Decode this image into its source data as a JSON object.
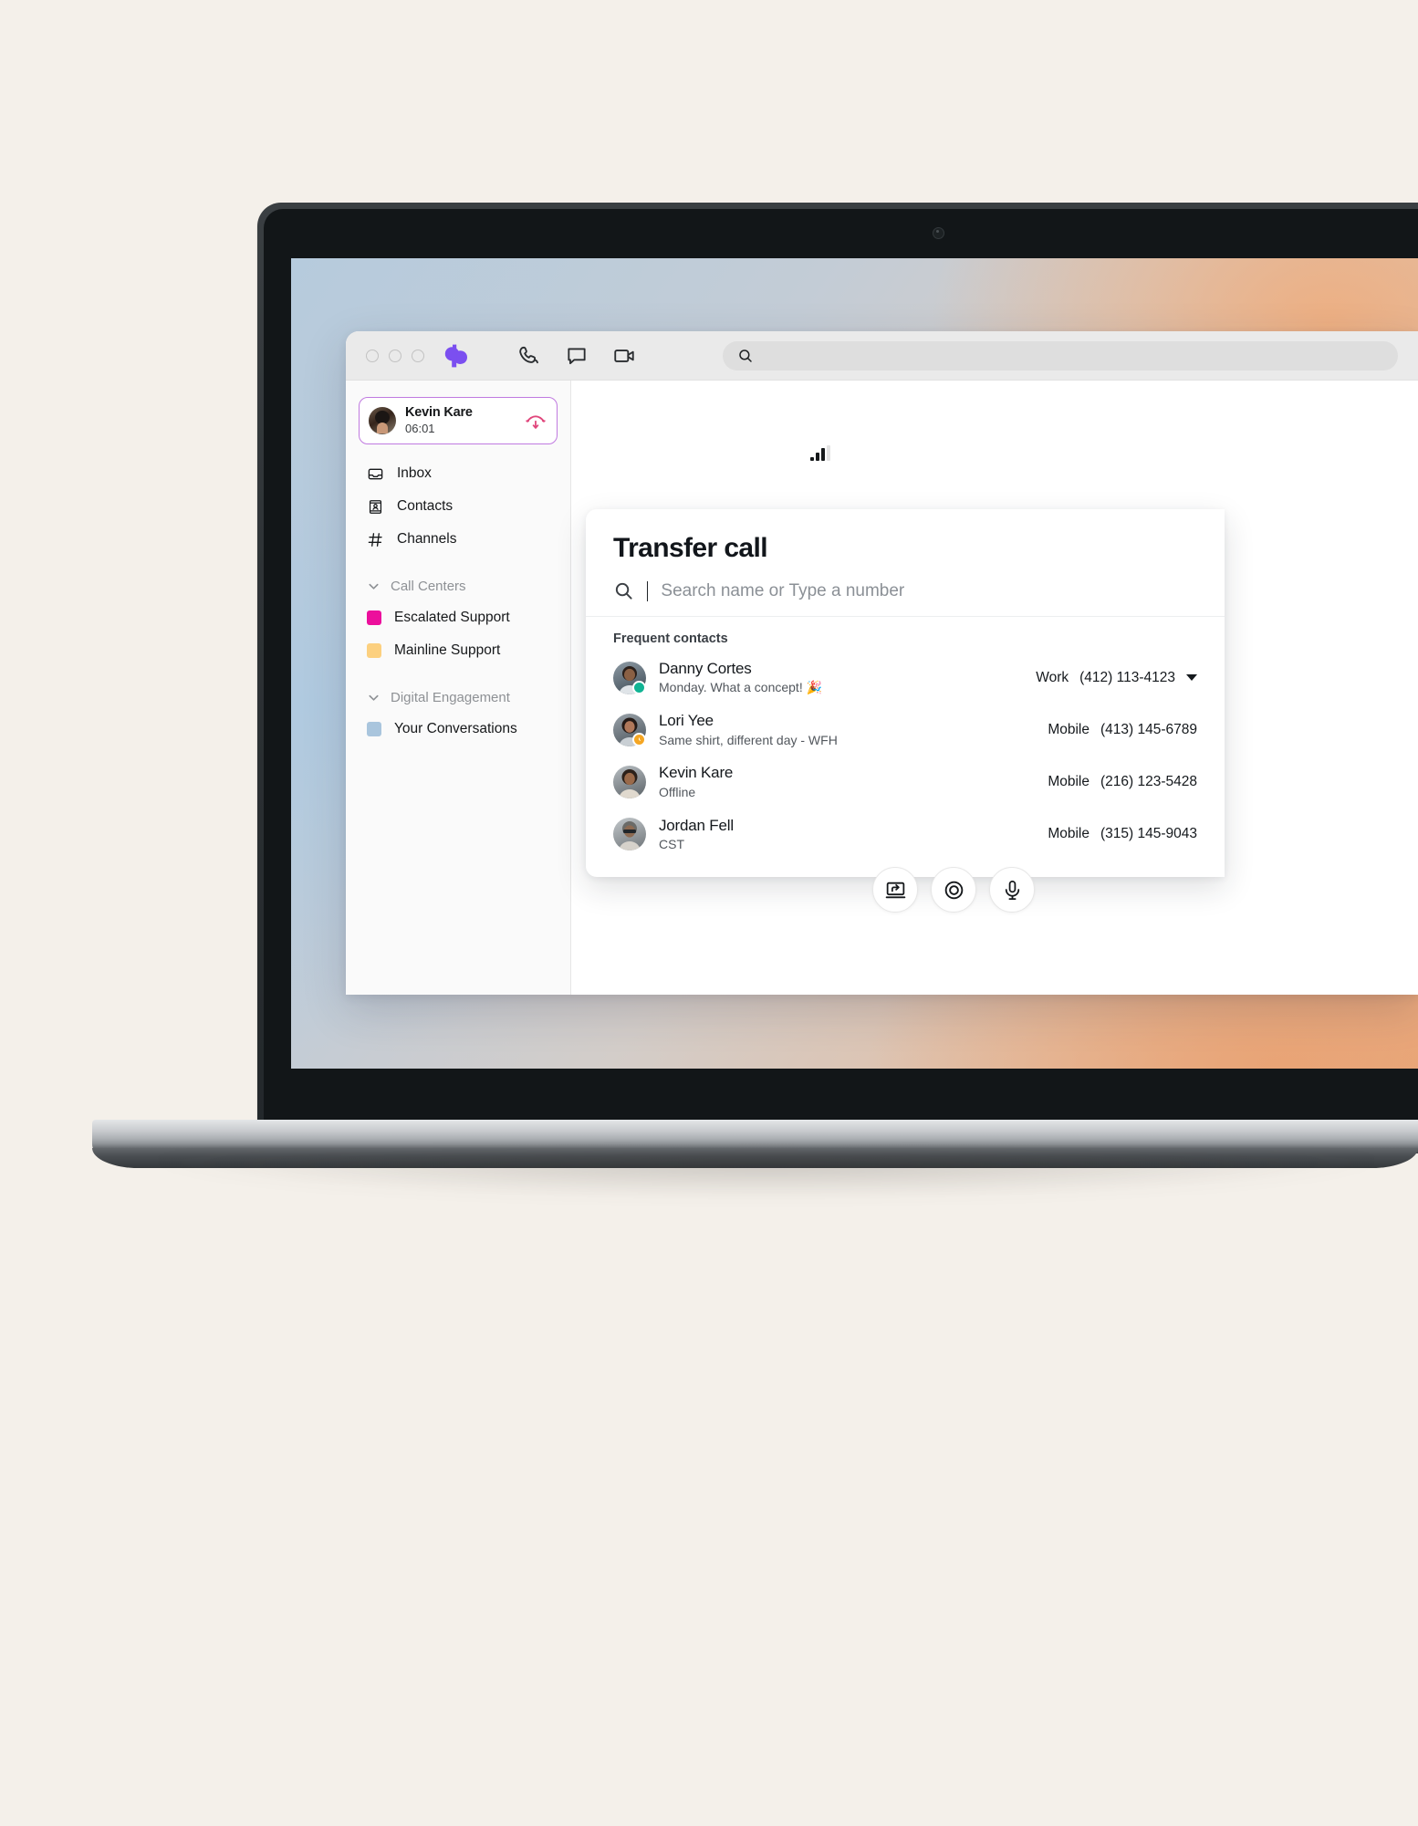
{
  "theme": {
    "page_background": "#f4f0ea",
    "brand_purple": "#7b4ff0",
    "accent_pink": "#e0457b",
    "card_border_purple": "#c07ae0"
  },
  "titlebar": {
    "window_controls": [
      "close",
      "minimize",
      "maximize"
    ],
    "logo_icon": "dialpad-logo-icon",
    "icons": [
      {
        "name": "phone-icon",
        "label": "Phone"
      },
      {
        "name": "message-icon",
        "label": "Messages"
      },
      {
        "name": "video-icon",
        "label": "Video"
      }
    ],
    "search": {
      "icon": "search-icon",
      "value": "",
      "placeholder": ""
    }
  },
  "sidebar": {
    "active_call": {
      "avatar_icon": "avatar",
      "name": "Kevin Kare",
      "timer": "06:01",
      "hangup_icon": "hangup-icon"
    },
    "nav_items": [
      {
        "icon": "inbox-icon",
        "label": "Inbox"
      },
      {
        "icon": "contacts-icon",
        "label": "Contacts"
      },
      {
        "icon": "hash-icon",
        "label": "Channels"
      }
    ],
    "groups": [
      {
        "chevron_icon": "chevron-down-icon",
        "label": "Call Centers",
        "channels": [
          {
            "label": "Escalated Support",
            "color": "#ec0f9c"
          },
          {
            "label": "Mainline Support",
            "color": "#fcd07f"
          }
        ]
      },
      {
        "chevron_icon": "chevron-down-icon",
        "label": "Digital Engagement",
        "channels": [
          {
            "label": "Your Conversations",
            "color": "#a9c5dd"
          }
        ]
      }
    ]
  },
  "main": {
    "signal_icon": "signal-strength-icon",
    "signal_bars_filled": 3,
    "signal_bars_total": 4,
    "transfer_dialog": {
      "title": "Transfer call",
      "search_icon": "search-icon",
      "search_value": "",
      "search_placeholder": "Search name or Type a number",
      "frequent_label": "Frequent contacts",
      "contacts": [
        {
          "name": "Danny Cortes",
          "status": "Monday. What a concept! 🎉",
          "presence": "online",
          "phone_label": "Work",
          "phone_number": "(412) 113-4123",
          "has_caret": true
        },
        {
          "name": "Lori Yee",
          "status": "Same shirt, different day - WFH",
          "presence": "away",
          "phone_label": "Mobile",
          "phone_number": "(413) 145-6789",
          "has_caret": false
        },
        {
          "name": "Kevin Kare",
          "status": "Offline",
          "presence": "none",
          "phone_label": "Mobile",
          "phone_number": "(216) 123-5428",
          "has_caret": false
        },
        {
          "name": "Jordan Fell",
          "status": "CST",
          "presence": "none",
          "phone_label": "Mobile",
          "phone_number": "(315) 145-9043",
          "has_caret": false
        }
      ]
    },
    "call_actions": [
      {
        "icon": "screen-transfer-icon",
        "label": "Transfer"
      },
      {
        "icon": "record-icon",
        "label": "Record"
      },
      {
        "icon": "microphone-icon",
        "label": "Mute"
      }
    ]
  }
}
